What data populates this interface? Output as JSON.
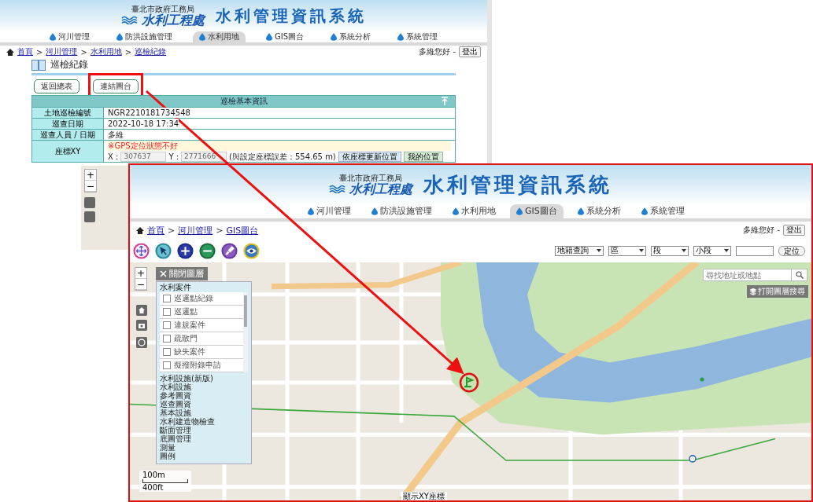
{
  "back_page": {
    "banner": {
      "agency": "臺北市政府工務局",
      "logo_text": "水利工程處",
      "system_title": "水利管理資訊系統"
    },
    "nav": [
      {
        "label": "河川管理",
        "selected": false
      },
      {
        "label": "防洪設施管理",
        "selected": false
      },
      {
        "label": "水利用地",
        "selected": true
      },
      {
        "label": "GIS圖台",
        "selected": false
      },
      {
        "label": "系統分析",
        "selected": false
      },
      {
        "label": "系統管理",
        "selected": false
      }
    ],
    "breadcrumb": {
      "separator": ">",
      "items": [
        "首頁",
        "河川管理",
        "水利用地",
        "巡檢紀錄"
      ]
    },
    "user": {
      "greeting": "多維您好 -",
      "logout": "登出"
    },
    "page_title": "巡檢紀錄",
    "actions": [
      {
        "label": "返回總表",
        "highlighted": false
      },
      {
        "label": "連結圖台",
        "highlighted": true
      }
    ],
    "info_table": {
      "title": "巡檢基本資訊",
      "rows": [
        {
          "label": "土地巡檢編號",
          "value": "NGR2210181734548"
        },
        {
          "label": "巡查日期",
          "value": "2022-10-18 17:34"
        },
        {
          "label": "巡查人員 / 日期",
          "value": "多維"
        }
      ],
      "coordinates": {
        "label": "座標XY",
        "warning": "※GPS定位狀態不好",
        "x_label": "X :",
        "x_value": "307637",
        "y_label": "Y :",
        "y_value": "2771666",
        "error_note": "(與設定座標誤差：554.65 m)",
        "buttons": [
          "依座標更新位置",
          "我的位置"
        ]
      }
    },
    "map_zoom": [
      "+",
      "−"
    ]
  },
  "front_page": {
    "banner": {
      "agency": "臺北市政府工務局",
      "logo_text": "水利工程處",
      "system_title": "水利管理資訊系統"
    },
    "nav": [
      {
        "label": "河川管理",
        "selected": false
      },
      {
        "label": "防洪設施管理",
        "selected": false
      },
      {
        "label": "水利用地",
        "selected": false
      },
      {
        "label": "GIS圖台",
        "selected": true
      },
      {
        "label": "系統分析",
        "selected": false
      },
      {
        "label": "系統管理",
        "selected": false
      }
    ],
    "breadcrumb": {
      "separator": ">",
      "items": [
        "首頁",
        "河川管理",
        "GIS圖台"
      ]
    },
    "user": {
      "greeting": "多維您好 -",
      "logout": "登出"
    },
    "tools": [
      {
        "kind": "pan"
      },
      {
        "kind": "select"
      },
      {
        "kind": "zoom_in"
      },
      {
        "kind": "zoom_out"
      },
      {
        "kind": "brush"
      },
      {
        "kind": "eye"
      }
    ],
    "filters": {
      "selects": [
        "地籍查詢",
        "區",
        "段",
        "小段"
      ],
      "button": "定位"
    },
    "map": {
      "zoom": [
        "+",
        "−"
      ],
      "layer_toggle": "關閉圖層",
      "layer_panel": {
        "section": "水利案件",
        "items": [
          {
            "label": "巡邏點紀錄",
            "checked": false
          },
          {
            "label": "巡邏點",
            "checked": false
          },
          {
            "label": "違規案件",
            "checked": false
          },
          {
            "label": "疏散門",
            "checked": false
          },
          {
            "label": "缺失案件",
            "checked": false
          },
          {
            "label": "擬撥附錄申請",
            "checked": false
          }
        ],
        "groups": [
          "水利設施(新版)",
          "水利設施",
          "參考圖資",
          "巡查圖資",
          "基本設施",
          "水利建造物檢查",
          "斷面管理",
          "底圖管理",
          "測量",
          "圖例"
        ]
      },
      "scale": {
        "metric": "100m",
        "imperial": "400ft"
      },
      "search": {
        "placeholder": "尋找地址或地點"
      },
      "layer_search": "打開圖層搜尋",
      "coordinate_toggle": "顯示XY座標"
    }
  }
}
